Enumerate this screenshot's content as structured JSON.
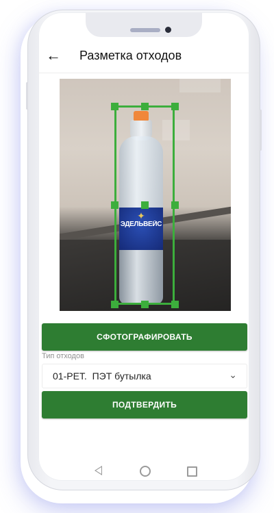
{
  "appbar": {
    "back_icon": "arrow-left-icon",
    "back_glyph": "←",
    "title": "Разметка отходов"
  },
  "photo": {
    "label_text": "ЭДЕЛЬВЕЙС"
  },
  "buttons": {
    "take_photo": "СФОТОГРАФИРОВАТЬ",
    "confirm": "ПОДТВЕРДИТЬ"
  },
  "waste_type": {
    "label": "Тип отходов",
    "selected": "01-PET.  ПЭТ бутылка",
    "chevron_icon": "chevron-down-icon",
    "chevron_glyph": "⌄"
  },
  "navbar": {
    "back_icon": "nav-back-icon",
    "home_icon": "nav-home-icon",
    "recent_icon": "nav-recent-icon"
  },
  "colors": {
    "primary": "#2e7d32",
    "bbox": "#3cae3c",
    "bottle_cap": "#f0873a",
    "label": "#1f3d99"
  }
}
